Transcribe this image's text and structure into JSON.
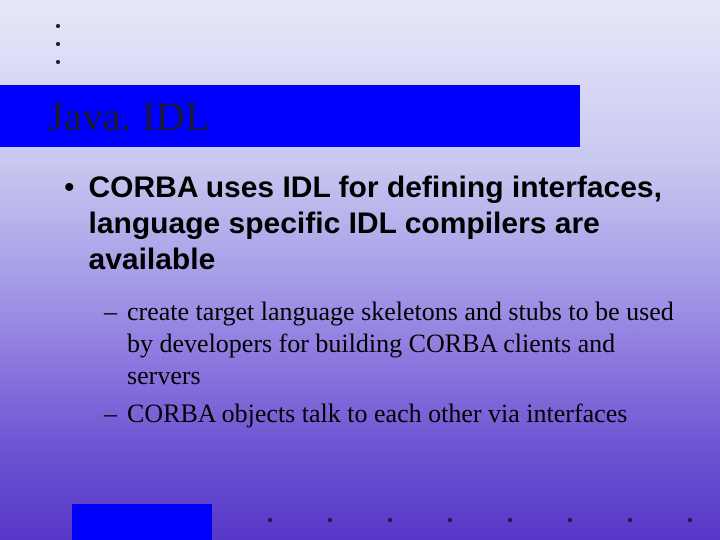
{
  "title": "Java. IDL",
  "bullets": [
    {
      "text": "CORBA uses IDL for defining interfaces, language specific IDL compilers are available",
      "children": [
        "create target language skeletons and stubs to be used by developers for building CORBA clients and servers",
        "CORBA objects talk to each other via interfaces"
      ]
    }
  ]
}
